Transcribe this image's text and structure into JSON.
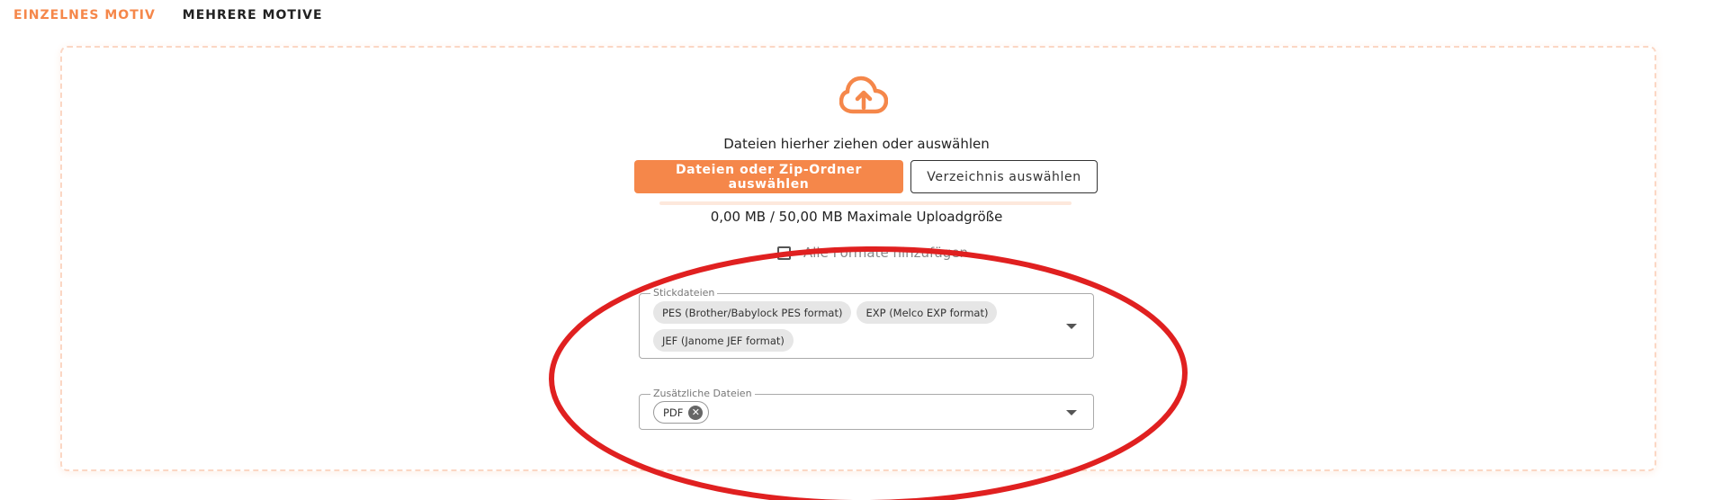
{
  "tabs": [
    {
      "label": "EINZELNES MOTIV",
      "active": true
    },
    {
      "label": "MEHRERE MOTIVE",
      "active": false
    }
  ],
  "upload": {
    "icon": "cloud-upload-icon",
    "hint": "Dateien hierher ziehen oder auswählen",
    "primary_button": "Dateien oder Zip-Ordner auswählen",
    "secondary_button": "Verzeichnis auswählen",
    "progress_percent": 0,
    "size_text": "0,00 MB / 50,00 MB Maximale Uploadgröße"
  },
  "checkbox": {
    "label": "Alle Formate hinzufügen",
    "checked": false
  },
  "stickdateien": {
    "label": "Stickdateien",
    "chips": [
      "PES (Brother/Babylock PES format)",
      "EXP (Melco EXP format)",
      "JEF (Janome JEF format)"
    ]
  },
  "zusaetzliche": {
    "label": "Zusätzliche Dateien",
    "chips": [
      "PDF"
    ]
  },
  "colors": {
    "accent": "#f5874a",
    "annotation": "#e02020"
  }
}
